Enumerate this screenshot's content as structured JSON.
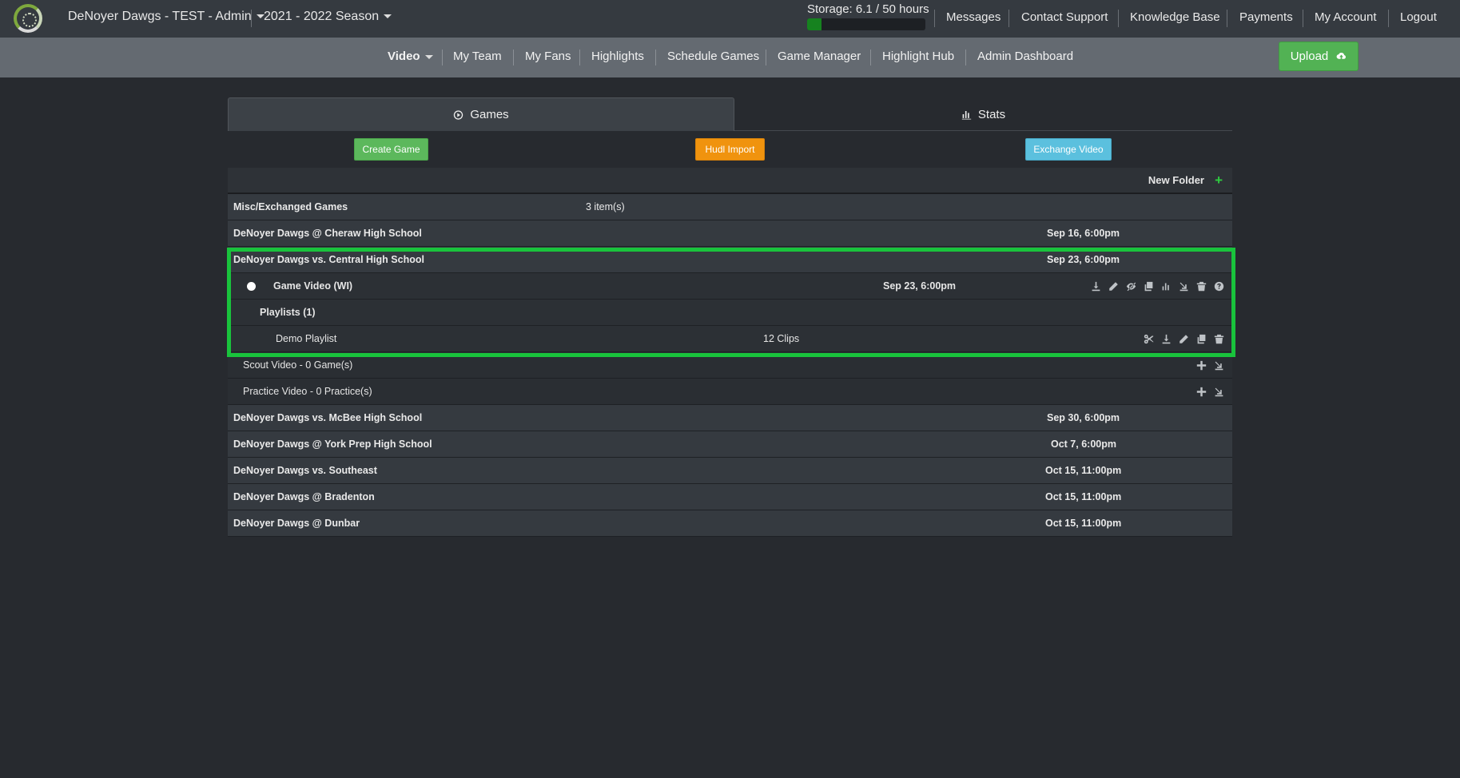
{
  "topbar": {
    "team": "DeNoyer Dawgs - TEST - Admin",
    "season": "2021 - 2022 Season",
    "storage_label": "Storage: 6.1 / 50 hours",
    "storage_fraction": 0.12,
    "links": [
      "Messages",
      "Contact Support",
      "Knowledge Base",
      "Payments",
      "My Account",
      "Logout"
    ]
  },
  "subnav": {
    "items": [
      "Video",
      "My Team",
      "My Fans",
      "Highlights",
      "Schedule Games",
      "Game Manager",
      "Highlight Hub",
      "Admin Dashboard"
    ],
    "upload": "Upload"
  },
  "tabs": {
    "games": "Games",
    "stats": "Stats"
  },
  "actions": {
    "create": "Create Game",
    "hudl": "Hudl Import",
    "exchange": "Exchange Video"
  },
  "table": {
    "new_folder": "New Folder",
    "rows": [
      {
        "title": "Misc/Exchanged Games",
        "count": "3 item(s)"
      },
      {
        "title": "DeNoyer Dawgs @ Cheraw High School",
        "date": "Sep 16, 6:00pm"
      },
      {
        "title": "DeNoyer Dawgs vs. Central High School",
        "date": "Sep 23, 6:00pm"
      },
      {
        "title": "Game Video (WI)",
        "date": "Sep 23, 6:00pm"
      },
      {
        "title": "Playlists (1)"
      },
      {
        "title": "Demo Playlist",
        "clips": "12 Clips"
      },
      {
        "title": "Scout Video - 0 Game(s)"
      },
      {
        "title": "Practice Video - 0 Practice(s)"
      },
      {
        "title": "DeNoyer Dawgs vs. McBee High School",
        "date": "Sep 30, 6:00pm"
      },
      {
        "title": "DeNoyer Dawgs @ York Prep High School",
        "date": "Oct 7, 6:00pm"
      },
      {
        "title": "DeNoyer Dawgs vs. Southeast",
        "date": "Oct 15, 11:00pm"
      },
      {
        "title": "DeNoyer Dawgs @ Bradenton",
        "date": "Oct 15, 11:00pm"
      },
      {
        "title": "DeNoyer Dawgs @ Dunbar",
        "date": "Oct 15, 11:00pm"
      }
    ]
  },
  "colors": {
    "highlight": "#19c33c",
    "upload": "#52b254",
    "hudl": "#f0930e",
    "exchange": "#5bc0de",
    "create": "#5cb85c"
  }
}
